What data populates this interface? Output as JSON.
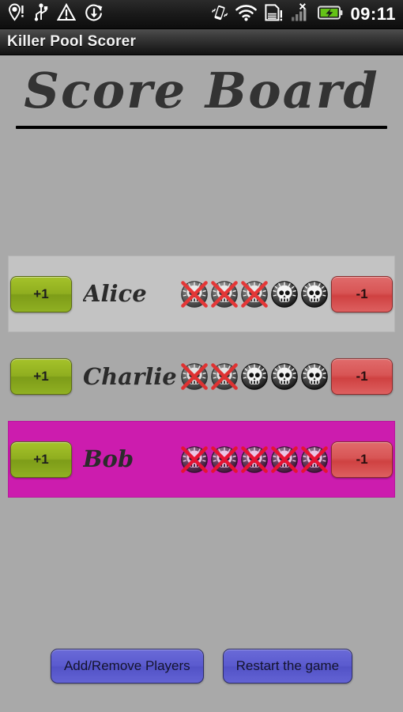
{
  "statusbar": {
    "time": "09:11",
    "left_icons": [
      {
        "name": "location-icon",
        "glyph": "location-alert"
      },
      {
        "name": "usb-icon",
        "glyph": "usb"
      },
      {
        "name": "upload-warning-icon",
        "glyph": "triangle-alert"
      },
      {
        "name": "sync-download-icon",
        "glyph": "sync-down"
      }
    ],
    "right_icons": [
      {
        "name": "vibrate-icon",
        "glyph": "vibrate"
      },
      {
        "name": "wifi-icon",
        "glyph": "wifi"
      },
      {
        "name": "sdcard-alert-icon",
        "glyph": "sdcard-alert"
      },
      {
        "name": "signal-no-service-icon",
        "glyph": "signal-x"
      },
      {
        "name": "battery-charging-icon",
        "glyph": "battery-charging"
      }
    ]
  },
  "titlebar": {
    "app_title": "Killer Pool Scorer"
  },
  "header": {
    "board_title": "Score Board"
  },
  "colors": {
    "page_background": "#a9a9a9",
    "row_highlight_grey": "#c3c3c3",
    "row_highlight_magenta": "#cc1cae",
    "plus_button": "#8fae1f",
    "minus_button": "#d85555",
    "bottom_button": "#5a5ace",
    "life_cross": "#ee1111"
  },
  "players": [
    {
      "name": "Alice",
      "plus_label": "+1",
      "minus_label": "-1",
      "lives_total": 5,
      "lives_lost": 3,
      "lives_remaining": 2,
      "highlight": "grey"
    },
    {
      "name": "Charlie",
      "plus_label": "+1",
      "minus_label": "-1",
      "lives_total": 5,
      "lives_lost": 2,
      "lives_remaining": 3,
      "highlight": "none"
    },
    {
      "name": "Bob",
      "plus_label": "+1",
      "minus_label": "-1",
      "lives_total": 5,
      "lives_lost": 5,
      "lives_remaining": 0,
      "highlight": "magenta"
    }
  ],
  "bottom_buttons": [
    {
      "name": "add-remove-players-button",
      "label": "Add/Remove Players"
    },
    {
      "name": "restart-game-button",
      "label": "Restart the game"
    }
  ]
}
